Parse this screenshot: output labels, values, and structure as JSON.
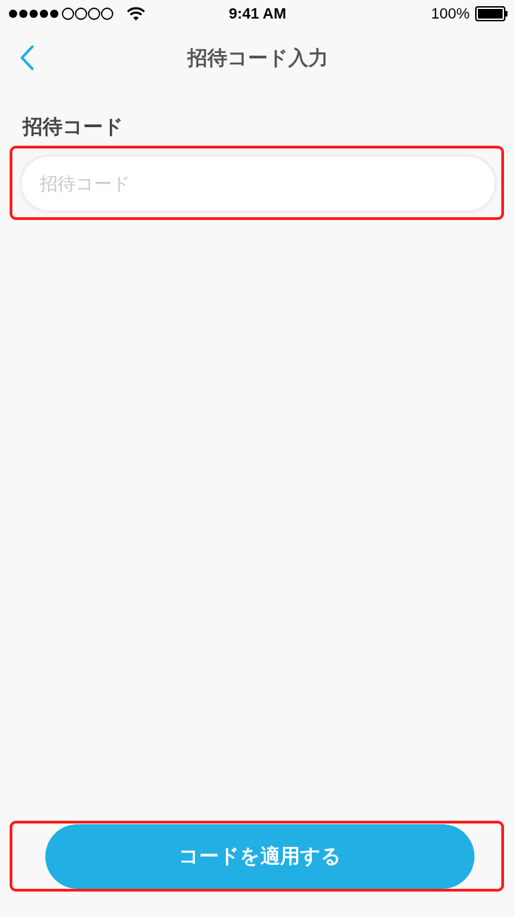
{
  "status_bar": {
    "time": "9:41 AM",
    "battery": "100%"
  },
  "nav": {
    "title": "招待コード入力"
  },
  "form": {
    "label": "招待コード",
    "field": {
      "placeholder": "招待コード",
      "highlighted": true
    }
  },
  "apply_button": {
    "label": "コードを適用する",
    "highlighted": true
  }
}
